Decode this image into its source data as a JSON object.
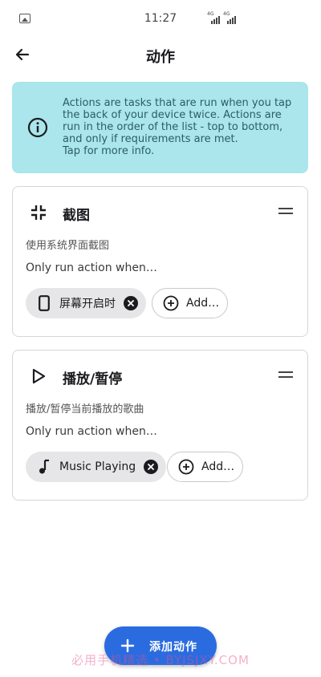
{
  "status_bar": {
    "time": "11:27",
    "signal_labels": [
      "4G",
      "4G"
    ]
  },
  "app_bar": {
    "title": "动作",
    "back_icon": "arrow-left-icon"
  },
  "info_banner": {
    "icon": "info-circle-icon",
    "text": "Actions are tasks that are run when you tap\nthe back of your device twice. Actions are\nrun in the order of the list - top to bottom,\nand only if requirements are met.\nTap for more info.",
    "background": "#aae6ec"
  },
  "actions": [
    {
      "icon": "shrink-arrows-icon",
      "title": "截图",
      "description": "使用系统界面截图",
      "condition_label": "Only run action when…",
      "requirement": {
        "icon": "phone-icon",
        "label": "屏幕开启时"
      },
      "add_label": "Add…"
    },
    {
      "icon": "play-icon",
      "title": "播放/暂停",
      "description": "播放/暂停当前播放的歌曲",
      "condition_label": "Only run action when…",
      "requirement": {
        "icon": "music-note-icon",
        "label": "Music Playing"
      },
      "add_label": "Add…"
    }
  ],
  "fab": {
    "icon": "plus-icon",
    "label": "添加动作",
    "color": "#2a6ce0"
  },
  "watermark": "必用手机精选 • BYJSJXY.COM"
}
